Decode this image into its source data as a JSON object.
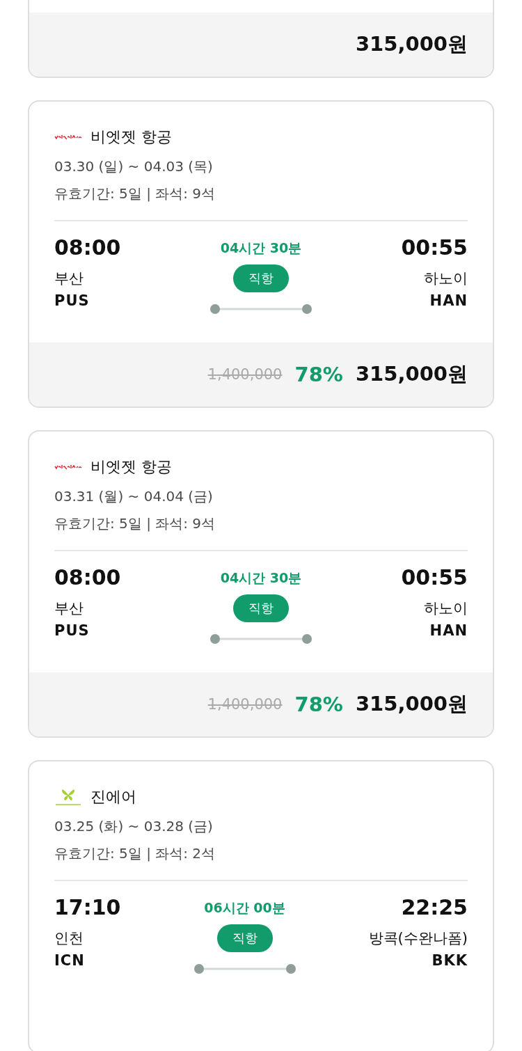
{
  "cards": [
    {
      "price": "315,000원"
    },
    {
      "kind": "vietjet",
      "airline": "비엣젯 항공",
      "dates": "03.30 (일) ~ 04.03 (목)",
      "validity": "유효기간: 5일 | 좌석: 9석",
      "depart_time": "08:00",
      "depart_city": "부산",
      "depart_code": "PUS",
      "duration": "04시간 30분",
      "flight_type": "직항",
      "arrive_time": "00:55",
      "arrive_city": "하노이",
      "arrive_code": "HAN",
      "original_price": "1,400,000",
      "discount": "78%",
      "price": "315,000원"
    },
    {
      "kind": "vietjet",
      "airline": "비엣젯 항공",
      "dates": "03.31 (월) ~ 04.04 (금)",
      "validity": "유효기간: 5일 | 좌석: 9석",
      "depart_time": "08:00",
      "depart_city": "부산",
      "depart_code": "PUS",
      "duration": "04시간 30분",
      "flight_type": "직항",
      "arrive_time": "00:55",
      "arrive_city": "하노이",
      "arrive_code": "HAN",
      "original_price": "1,400,000",
      "discount": "78%",
      "price": "315,000원"
    },
    {
      "kind": "jinair",
      "airline": "진에어",
      "dates": "03.25 (화) ~ 03.28 (금)",
      "validity": "유효기간: 5일 | 좌석: 2석",
      "depart_time": "17:10",
      "depart_city": "인천",
      "depart_code": "ICN",
      "duration": "06시간 00분",
      "flight_type": "직항",
      "arrive_time": "22:25",
      "arrive_city": "방콕(수완나폼)",
      "arrive_code": "BKK"
    }
  ]
}
